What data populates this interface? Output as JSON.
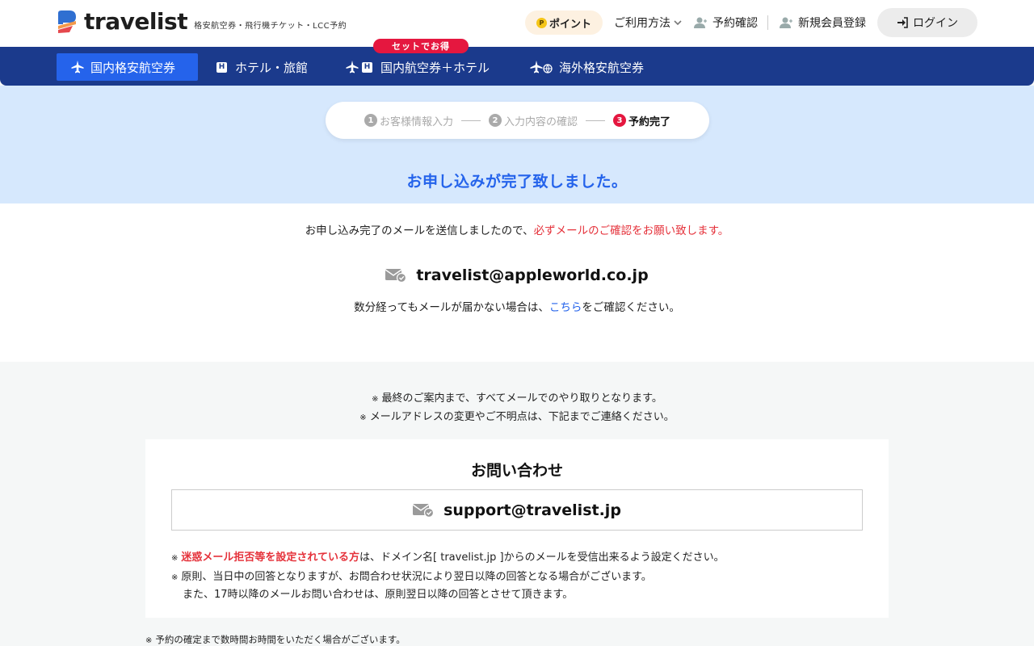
{
  "header": {
    "logo_text": "travelist",
    "tagline": "格安航空券・飛行機チケット・LCC予約",
    "point_coin": "P",
    "point_label": "ポイント",
    "usage_label": "ご利用方法",
    "reservation_label": "予約確認",
    "register_label": "新規会員登録",
    "login_label": "ログイン"
  },
  "nav": {
    "items": [
      {
        "label": "国内格安航空券"
      },
      {
        "label": "ホテル・旅館"
      },
      {
        "label": "国内航空券＋ホテル"
      },
      {
        "label": "海外格安航空券"
      }
    ],
    "hotel_glyph": "H",
    "set_badge": "セットでお得"
  },
  "steps": {
    "items": [
      {
        "num": "1",
        "label": "お客様情報入力"
      },
      {
        "num": "2",
        "label": "入力内容の確認"
      },
      {
        "num": "3",
        "label": "予約完了"
      }
    ]
  },
  "completion": {
    "title": "お申し込みが完了致しました。",
    "sent_msg_prefix": "お申し込み完了のメールを送信しましたので、",
    "sent_msg_emphasis": "必ずメールのご確認をお願い致します。",
    "email": "travelist@appleworld.co.jp",
    "noarrive_prefix": "数分経ってもメールが届かない場合は、",
    "noarrive_link": "こちら",
    "noarrive_suffix": "をご確認ください。"
  },
  "notes": {
    "kome": "※",
    "line1": "最終のご案内まで、すべてメールでのやり取りとなります。",
    "line2": "メールアドレスの変更やご不明点は、下記までご連絡ください。"
  },
  "contact": {
    "title": "お問い合わせ",
    "email": "support@travelist.jp",
    "note1_emphasis": "迷惑メール拒否等を設定されている方",
    "note1_rest": "は、ドメイン名[ travelist.jp ]からのメールを受信出来るよう設定ください。",
    "note2_line1": "原則、当日中の回答となりますが、お問合わせ状況により翌日以降の回答となる場合がございます。",
    "note2_line2": "また、17時以降のメールお問い合わせは、原則翌日以降の回答とさせて頂きます。"
  },
  "footer_note": "予約の確定まで数時間お時間をいただく場合がございます。",
  "colors": {
    "nav_bg": "#1b3a8c",
    "active_tab": "#2563eb",
    "accent_red": "#e5173f",
    "title_blue": "#2463eb",
    "banner_bg": "#d6e8fd"
  }
}
